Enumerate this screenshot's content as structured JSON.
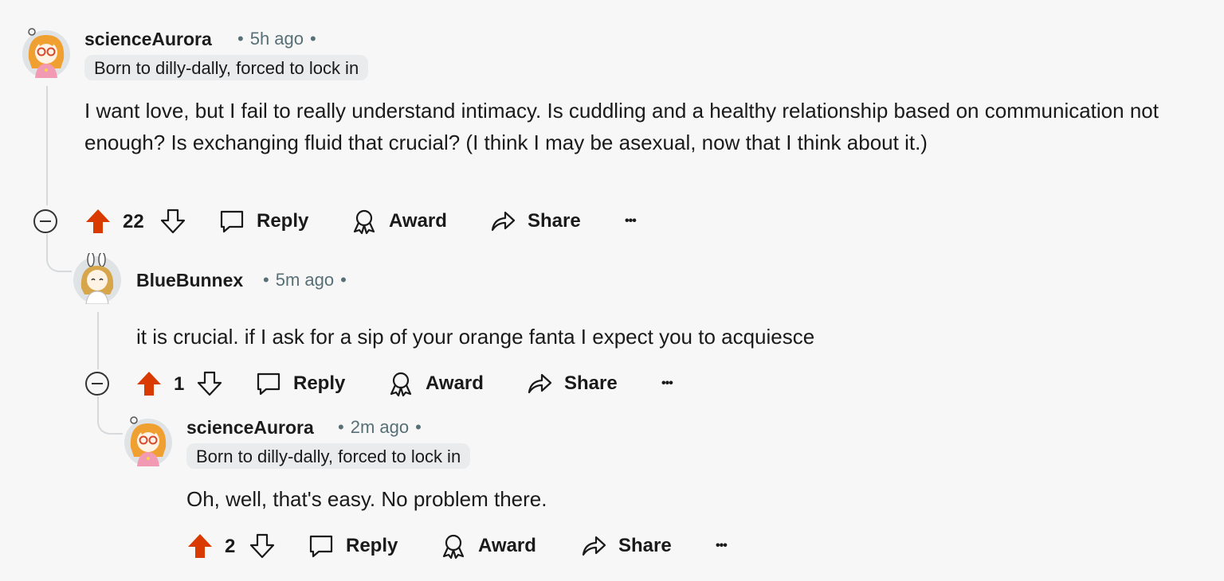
{
  "comments": [
    {
      "username": "scienceAurora",
      "time": "5h ago",
      "flair": "Born to dilly-dally, forced to lock in",
      "text": "I want love, but I fail to really understand intimacy. Is cuddling and a healthy relationship based on communication not enough? Is exchanging fluid that crucial? (I think I may be asexual, now that I think about it.)",
      "score": "22"
    },
    {
      "username": "BlueBunnex",
      "time": "5m ago",
      "text": "it is crucial. if I ask for a sip of your orange fanta I expect you to acquiesce",
      "score": "1"
    },
    {
      "username": "scienceAurora",
      "time": "2m ago",
      "flair": "Born to dilly-dally, forced to lock in",
      "text": "Oh, well, that's easy. No problem there.",
      "score": "2"
    }
  ],
  "actions": {
    "reply": "Reply",
    "award": "Award",
    "share": "Share",
    "more": "•••"
  },
  "colors": {
    "upvote_active": "#d93a00",
    "thread_line": "#d6dadc",
    "flair_bg": "#e9ebec",
    "meta_text": "#576f76"
  }
}
